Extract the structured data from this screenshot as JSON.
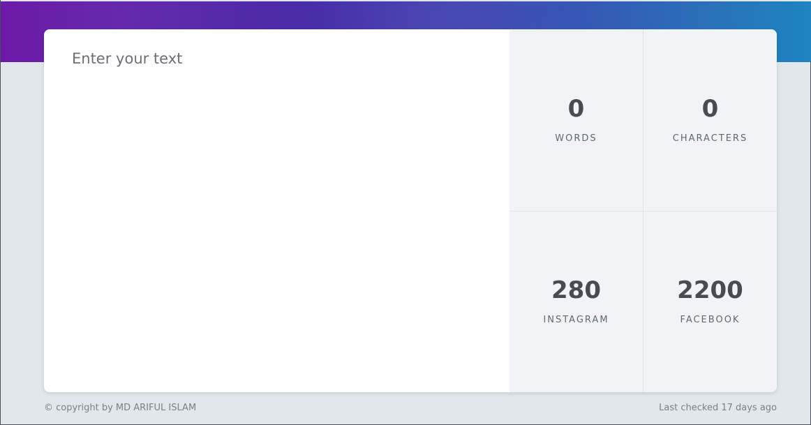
{
  "editor": {
    "placeholder": "Enter your text",
    "value": ""
  },
  "stats": {
    "words": {
      "value": "0",
      "label": "WORDS"
    },
    "characters": {
      "value": "0",
      "label": "CHARACTERS"
    },
    "instagram": {
      "value": "280",
      "label": "INSTAGRAM"
    },
    "facebook": {
      "value": "2200",
      "label": "FACEBOOK"
    }
  },
  "footer": {
    "copyright": "© copyright by MD ARIFUL ISLAM",
    "last_checked": "Last checked 17 days ago"
  },
  "colors": {
    "gradient_start": "#6a16a6",
    "gradient_end": "#1d84c0",
    "page_bg": "#e1e7ea",
    "stats_bg": "#f0f4f7"
  }
}
